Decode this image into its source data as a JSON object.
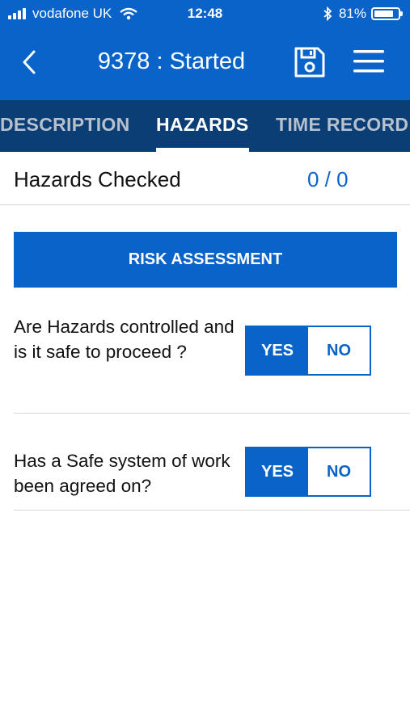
{
  "status_bar": {
    "carrier": "vodafone UK",
    "time": "12:48",
    "battery_percent": "81%",
    "battery_level": 0.81,
    "icons": [
      "signal-icon",
      "wifi-icon",
      "bluetooth-icon",
      "battery-icon"
    ]
  },
  "header": {
    "title": "9378 : Started",
    "icons": [
      "back-chevron-icon",
      "save-icon",
      "menu-icon"
    ],
    "color": "#0a63c9"
  },
  "tabs": [
    {
      "label": "DESCRIPTION",
      "active": false
    },
    {
      "label": "HAZARDS",
      "active": true
    },
    {
      "label": "TIME RECORD",
      "active": false
    }
  ],
  "hazards_checked": {
    "label": "Hazards Checked",
    "value": "0 / 0"
  },
  "risk_assessment_label": "RISK ASSESSMENT",
  "questions": [
    {
      "text": "Are Hazards controlled and is it safe to proceed ?",
      "yes_label": "YES",
      "no_label": "NO",
      "selected": "YES"
    },
    {
      "text": "Has a Safe system of work been agreed on?",
      "yes_label": "YES",
      "no_label": "NO",
      "selected": "YES"
    }
  ],
  "colors": {
    "primary": "#0a63c9",
    "tab_bar": "#0c3e76",
    "tab_inactive": "#b7c1cd"
  }
}
